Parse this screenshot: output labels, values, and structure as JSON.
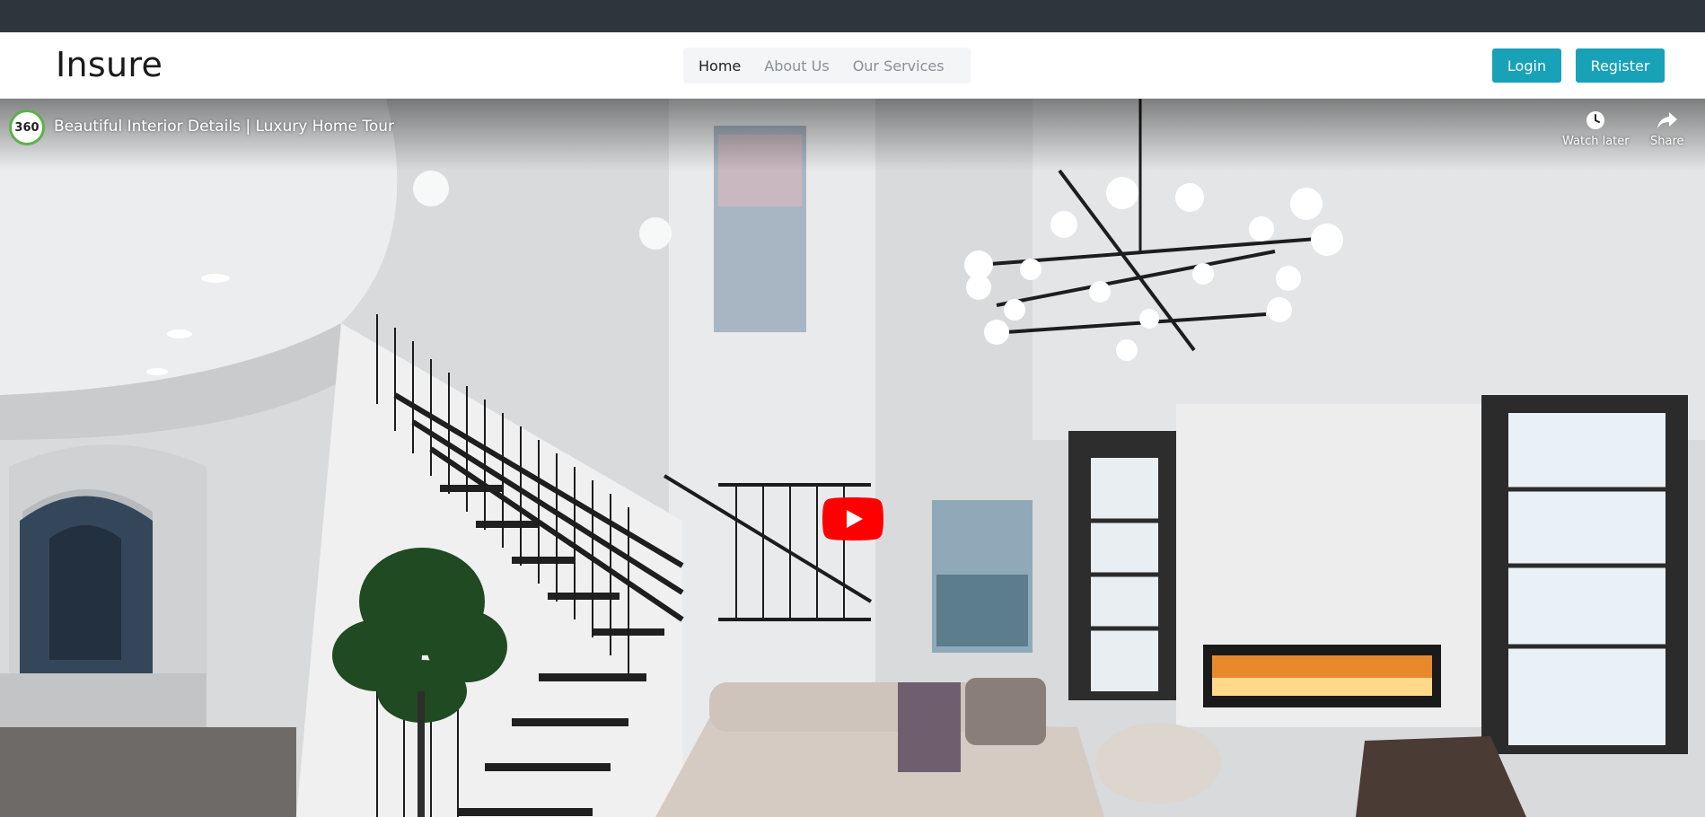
{
  "brand": "Insure",
  "nav": {
    "links": [
      {
        "label": "Home",
        "active": true
      },
      {
        "label": "About Us",
        "active": false
      },
      {
        "label": "Our Services",
        "active": false
      }
    ]
  },
  "auth": {
    "login_label": "Login",
    "register_label": "Register"
  },
  "video": {
    "channel_badge": "360",
    "title": "Beautiful Interior Details | Luxury Home Tour",
    "watch_later_label": "Watch later",
    "share_label": "Share",
    "watch_later_icon": "clock-icon",
    "share_icon": "share-arrow-icon",
    "play_icon": "youtube-play-icon"
  },
  "colors": {
    "accent": "#17a2b8",
    "topbar": "#2f353d",
    "youtube_red": "#ff0000"
  }
}
